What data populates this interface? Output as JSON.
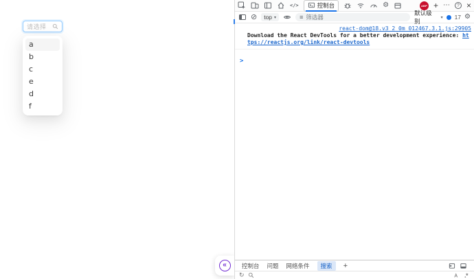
{
  "colors": {
    "accent_blue": "#1a73e8",
    "link_blue": "#1a66cc",
    "purple": "#722ed1",
    "abp_red": "#c70d2c",
    "select_focus_border": "#91caff",
    "drawer_active_tab_bg": "#dbe7f8"
  },
  "icons": {
    "collapse": "«",
    "elements_glyph": "</>",
    "gear": "⚙",
    "clear": "⊘",
    "filter": "≡",
    "add": "+",
    "more": "⋯",
    "help": "?",
    "close": "×",
    "dropdown_arrow": "▾",
    "refresh": "↻"
  },
  "page": {
    "select": {
      "placeholder": "请选择",
      "options": [
        "a",
        "b",
        "c",
        "e",
        "d",
        "f"
      ]
    }
  },
  "devtools": {
    "toolbar": {
      "console_tab": "控制台",
      "abp_label": "ABP"
    },
    "console_toolbar": {
      "context": "top",
      "filter_placeholder": "筛选器",
      "level_label": "默认级别",
      "issues_count": "17"
    },
    "console": {
      "source_link": "react-dom@18.v3_2_0m_012467.3.1.js:29905",
      "message": "Download the React DevTools for a better development experience:",
      "message_link": "https://reactjs.org/link/react-devtools",
      "prompt": ">"
    },
    "drawer": {
      "tabs": [
        "控制台",
        "问题",
        "网络条件",
        "搜索"
      ],
      "active_tab": "搜索",
      "add": "+"
    }
  }
}
